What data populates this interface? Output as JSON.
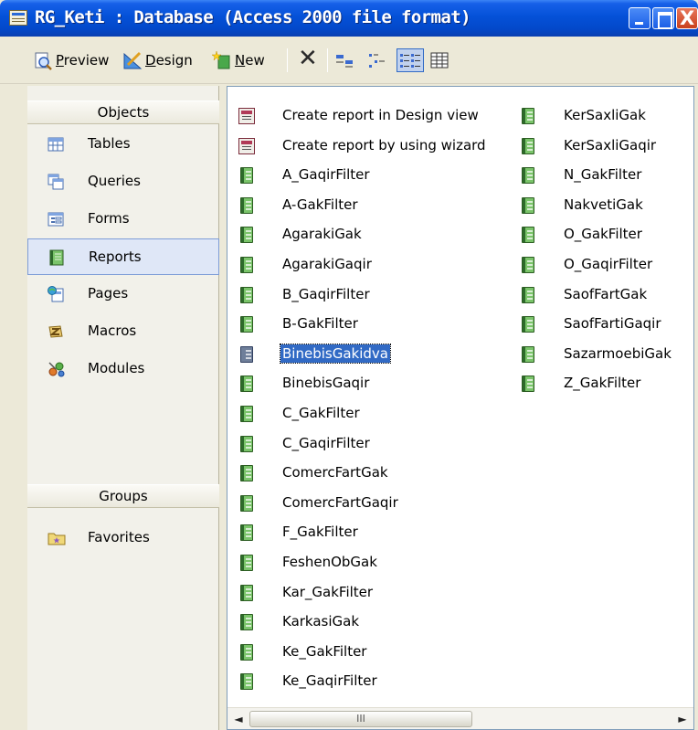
{
  "window": {
    "title": "RG_Keti : Database (Access 2000 file format)",
    "close_glyph": "X"
  },
  "toolbar": {
    "preview_label": "Preview",
    "design_label": "Design",
    "new_label": "New",
    "delete_glyph": "✕"
  },
  "left_pane": {
    "objects_header": "Objects",
    "groups_header": "Groups",
    "objects": [
      {
        "label": "Tables",
        "icon": "table-icon"
      },
      {
        "label": "Queries",
        "icon": "query-icon"
      },
      {
        "label": "Forms",
        "icon": "form-icon"
      },
      {
        "label": "Reports",
        "icon": "report-icon",
        "selected": true
      },
      {
        "label": "Pages",
        "icon": "page-icon"
      },
      {
        "label": "Macros",
        "icon": "macro-icon"
      },
      {
        "label": "Modules",
        "icon": "module-icon"
      }
    ],
    "groups": [
      {
        "label": "Favorites",
        "icon": "favorites-folder-icon"
      }
    ]
  },
  "report_list": {
    "column1": [
      "Create report in Design view",
      "Create report by using wizard",
      "A_GaqirFilter",
      "A-GakFilter",
      "AgarakiGak",
      "AgarakiGaqir",
      "B_GaqirFilter",
      "B-GakFilter",
      "BinebisGakidva",
      "BinebisGaqir",
      "C_GakFilter",
      "C_GaqirFilter",
      "ComercFartGak",
      "ComercFartGaqir",
      "F_GakFilter",
      "FeshenObGak",
      "Kar_GakFilter",
      "KarkasiGak",
      "Ke_GakFilter",
      "Ke_GaqirFilter"
    ],
    "column2": [
      "KerSaxliGak",
      "KerSaxliGaqir",
      "N_GakFilter",
      "NakvetiGak",
      "O_GakFilter",
      "O_GaqirFilter",
      "SaofFartGak",
      "SaofFartiGaqir",
      "SazarmoebiGak",
      "Z_GakFilter"
    ],
    "selected": "BinebisGakidva"
  },
  "scrollbar": {
    "left_arrow": "◄",
    "right_arrow": "►",
    "thumb_grip": "III"
  }
}
